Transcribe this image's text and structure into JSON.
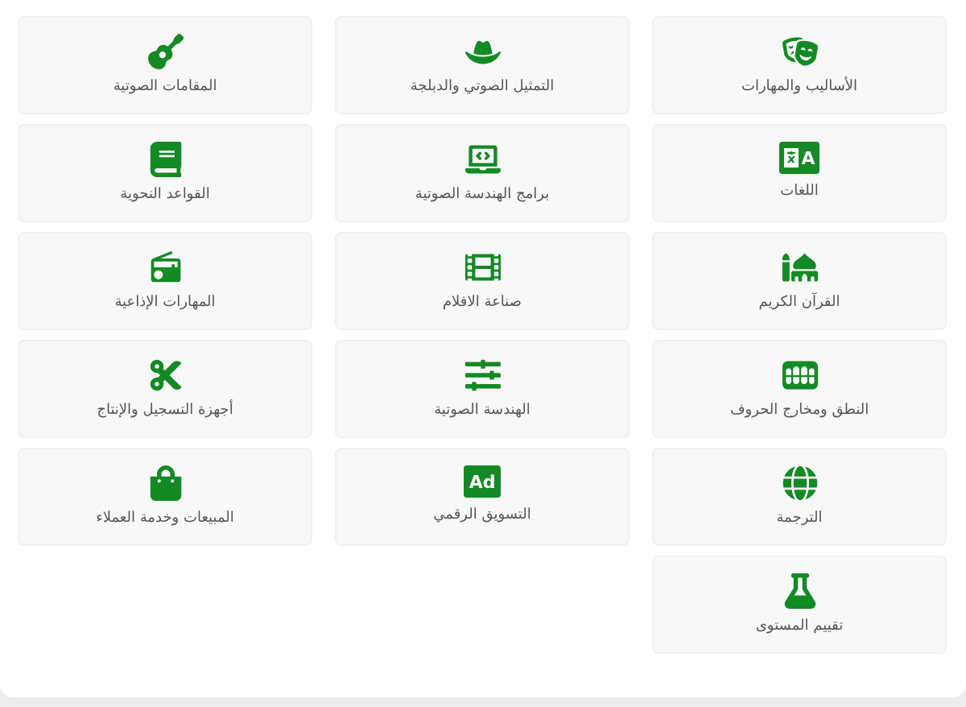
{
  "categories": [
    {
      "label": "الأساليب والمهارات"
    },
    {
      "label": "التمثيل الصوتي والدبلجة"
    },
    {
      "label": "المقامات الصوتية"
    },
    {
      "label": "اللغات",
      "badge": "A"
    },
    {
      "label": "برامج الهندسة الصوتية"
    },
    {
      "label": "القواعد النحوية"
    },
    {
      "label": "القرآن الكريم"
    },
    {
      "label": "صناعة الافلام"
    },
    {
      "label": "المهارات الإذاعية"
    },
    {
      "label": "النطق ومخارج الحروف"
    },
    {
      "label": "الهندسة الصوتية"
    },
    {
      "label": "أجهزة التسجيل والإنتاج"
    },
    {
      "label": "الترجمة"
    },
    {
      "label": "التسويق الرقمي",
      "badge": "Ad"
    },
    {
      "label": "المبيعات وخدمة العملاء"
    },
    {
      "label": "تقييم المستوى"
    }
  ]
}
